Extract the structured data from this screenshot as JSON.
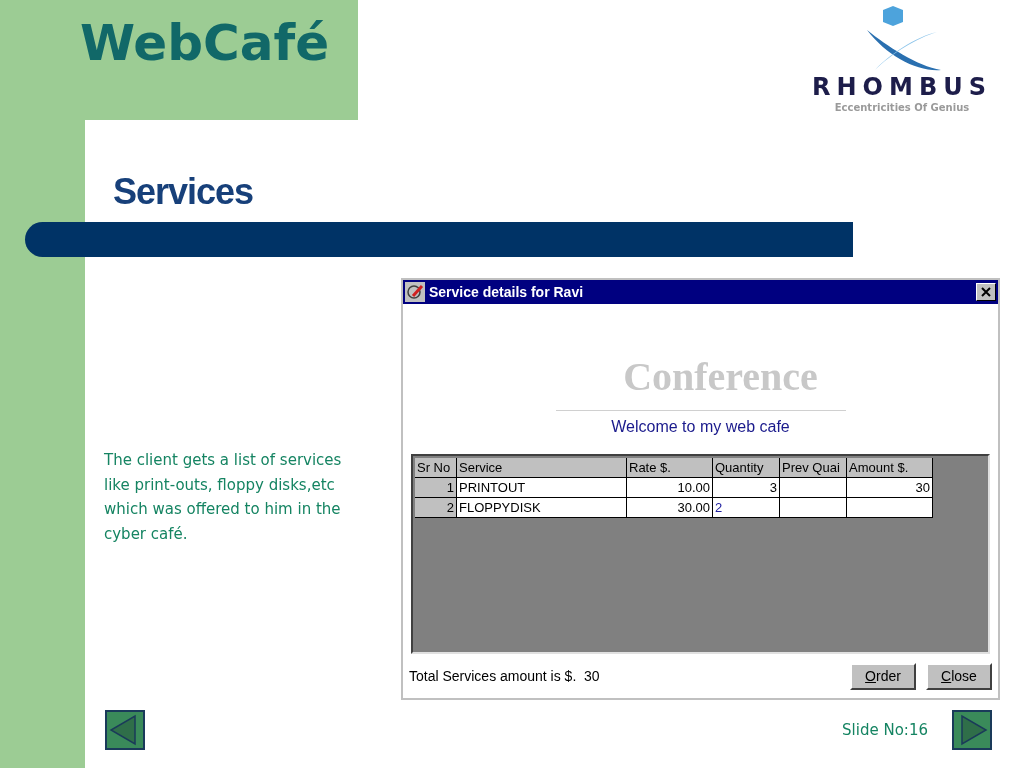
{
  "slide": {
    "title": "WebCafé",
    "heading": "Services",
    "body": "The client gets a list of services like print-outs, floppy disks,etc which was offered to him in the cyber café.",
    "slide_number": "Slide No:16"
  },
  "logo": {
    "name": "RHOMBUS",
    "tagline": "Eccentricities Of Genius"
  },
  "window": {
    "title": "Service details for Ravi",
    "banner": "Conference",
    "welcome": "Welcome to my web cafe",
    "table": {
      "columns": [
        "Sr No",
        "Service",
        "Rate $.",
        "Quantity",
        "Prev Quai",
        "Amount $."
      ],
      "rows": [
        {
          "sr": "1",
          "service": "PRINTOUT",
          "rate": "10.00",
          "quantity": "3",
          "amount": "30",
          "editing": false
        },
        {
          "sr": "2",
          "service": "FLOPPYDISK",
          "rate": "30.00",
          "quantity": "2",
          "editing": true
        }
      ]
    },
    "total": "Total Services amount is $.  30",
    "buttons": [
      "Order",
      "Close"
    ]
  }
}
